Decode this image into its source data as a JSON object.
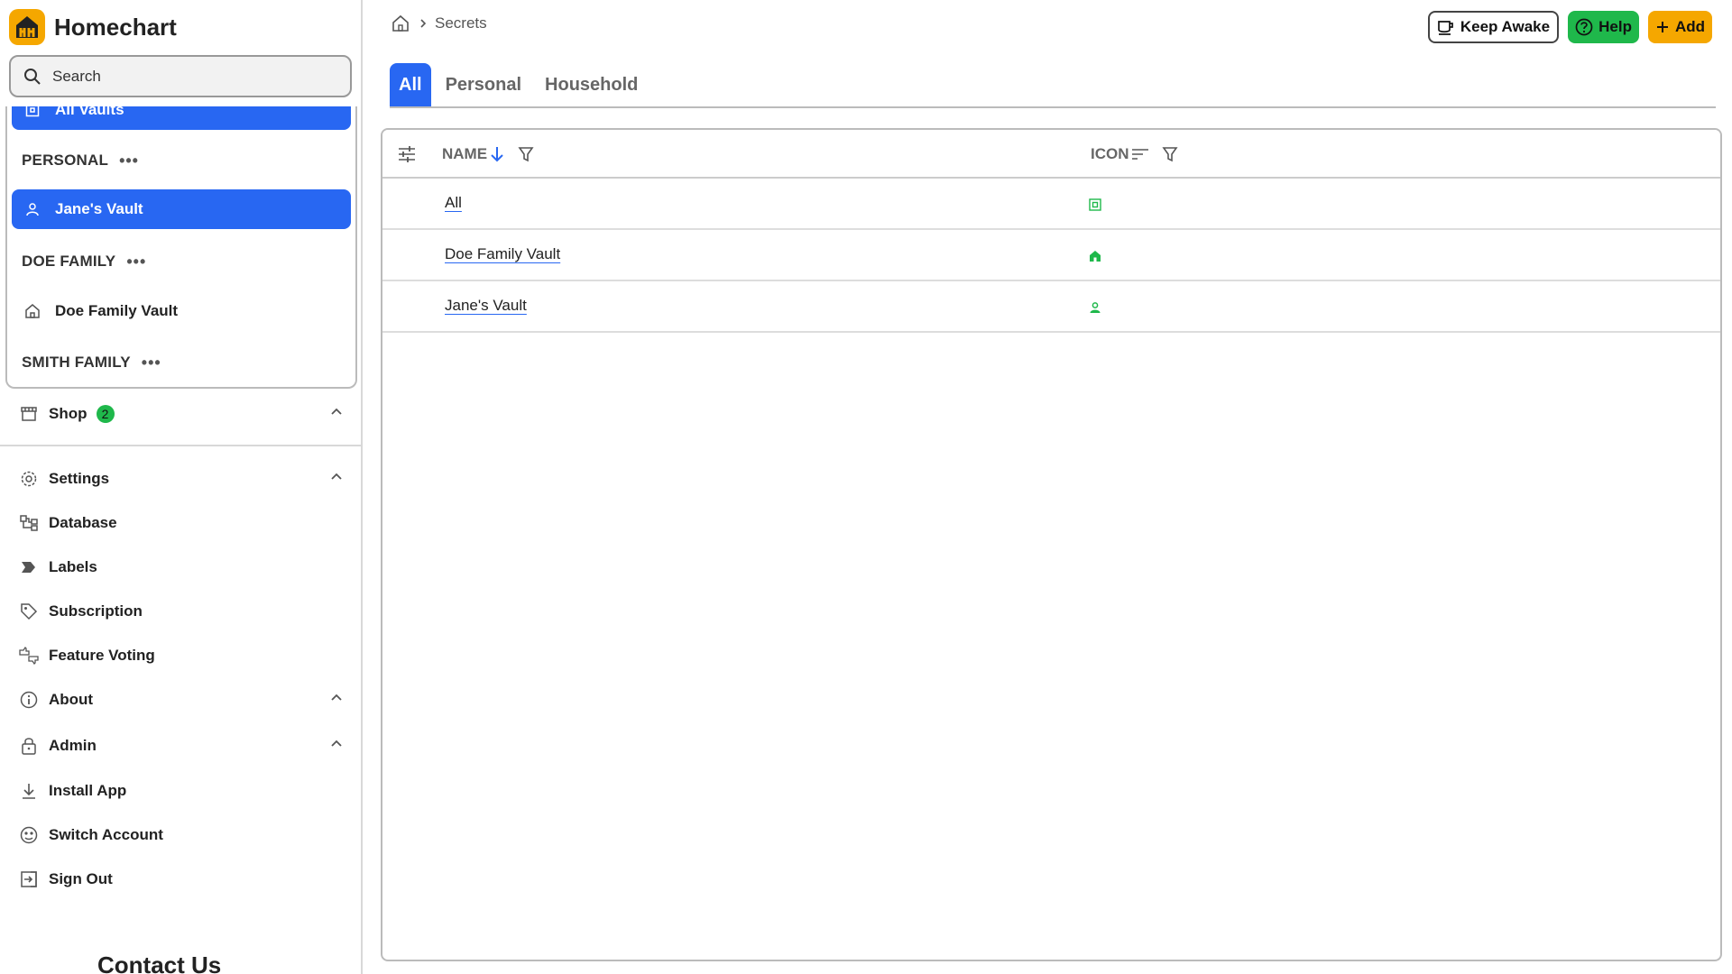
{
  "app": {
    "name": "Homechart"
  },
  "search": {
    "placeholder": "Search"
  },
  "vaults": {
    "all_label": "All Vaults",
    "personal_heading": "PERSONAL",
    "personal_item": "Jane's Vault",
    "doe_heading": "DOE FAMILY",
    "doe_item": "Doe Family Vault",
    "smith_heading": "SMITH FAMILY",
    "more_glyph": "•••"
  },
  "nav": {
    "shop": {
      "label": "Shop",
      "badge": "2"
    },
    "settings": "Settings",
    "database": "Database",
    "labels": "Labels",
    "subscription": "Subscription",
    "feature_voting": "Feature Voting",
    "about": "About",
    "admin": "Admin",
    "install_app": "Install App",
    "switch_account": "Switch Account",
    "sign_out": "Sign Out"
  },
  "contact": "Contact Us",
  "breadcrumb": {
    "current": "Secrets"
  },
  "actions": {
    "keep_awake": "Keep Awake",
    "help": "Help",
    "add": "Add"
  },
  "tabs": [
    "All",
    "Personal",
    "Household"
  ],
  "active_tab": "All",
  "table": {
    "columns": {
      "name": "NAME",
      "icon": "ICON"
    },
    "sort": {
      "column": "name",
      "direction": "descending"
    },
    "rows": [
      {
        "name": "All",
        "icon": "all-vaults-icon"
      },
      {
        "name": "Doe Family Vault",
        "icon": "home-icon"
      },
      {
        "name": "Jane's Vault",
        "icon": "person-icon"
      }
    ]
  },
  "colors": {
    "primary": "#2867f2",
    "accent": "#f5a700",
    "success": "#1fb84b",
    "icon_green": "#1fb84b"
  }
}
